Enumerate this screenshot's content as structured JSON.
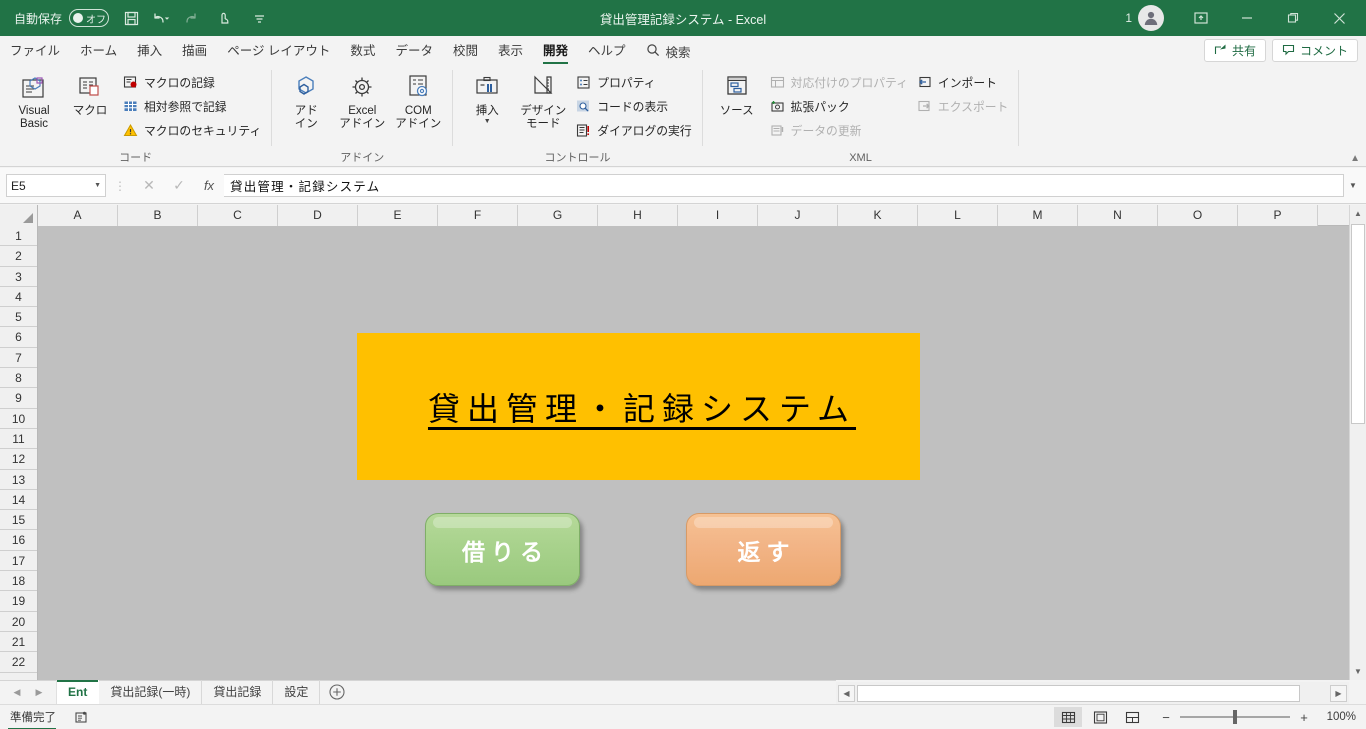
{
  "titlebar": {
    "autosave_label": "自動保存",
    "autosave_state": "オフ",
    "quick_access": [
      "save-icon",
      "undo-icon",
      "redo-icon",
      "touch-mode-icon",
      "customize-qat-icon"
    ],
    "document_title": "貸出管理記録システム  -  Excel",
    "user_count": "1",
    "window_buttons": [
      "ribbon-display-options",
      "minimize",
      "restore",
      "close"
    ]
  },
  "tabs": [
    {
      "label": "ファイル",
      "active": false
    },
    {
      "label": "ホーム",
      "active": false
    },
    {
      "label": "挿入",
      "active": false
    },
    {
      "label": "描画",
      "active": false
    },
    {
      "label": "ページ レイアウト",
      "active": false
    },
    {
      "label": "数式",
      "active": false
    },
    {
      "label": "データ",
      "active": false
    },
    {
      "label": "校閲",
      "active": false
    },
    {
      "label": "表示",
      "active": false
    },
    {
      "label": "開発",
      "active": true
    },
    {
      "label": "ヘルプ",
      "active": false
    }
  ],
  "search": {
    "label": "検索"
  },
  "tabbar_right": {
    "share": "共有",
    "comments": "コメント"
  },
  "ribbon": {
    "groups": [
      {
        "name": "code",
        "label": "コード",
        "big": [
          {
            "label": "Visual Basic",
            "icon": "visual-basic-icon"
          },
          {
            "label": "マクロ",
            "icon": "macro-icon"
          }
        ],
        "small": [
          {
            "label": "マクロの記録",
            "icon": "record-macro-icon",
            "disabled": false
          },
          {
            "label": "相対参照で記録",
            "icon": "relative-reference-icon",
            "disabled": false
          },
          {
            "label": "マクロのセキュリティ",
            "icon": "macro-security-icon",
            "disabled": false
          }
        ]
      },
      {
        "name": "addins",
        "label": "アドイン",
        "big": [
          {
            "label": "アド\nイン",
            "icon": "addins-icon"
          },
          {
            "label": "Excel\nアドイン",
            "icon": "excel-addins-icon"
          },
          {
            "label": "COM\nアドイン",
            "icon": "com-addins-icon"
          }
        ],
        "small": []
      },
      {
        "name": "controls",
        "label": "コントロール",
        "big": [
          {
            "label": "挿入",
            "icon": "insert-control-icon",
            "has_caret": true
          },
          {
            "label": "デザイン\nモード",
            "icon": "design-mode-icon"
          }
        ],
        "small": [
          {
            "label": "プロパティ",
            "icon": "properties-icon",
            "disabled": false
          },
          {
            "label": "コードの表示",
            "icon": "view-code-icon",
            "disabled": false
          },
          {
            "label": "ダイアログの実行",
            "icon": "run-dialog-icon",
            "disabled": false
          }
        ]
      },
      {
        "name": "xml",
        "label": "XML",
        "big": [
          {
            "label": "ソース",
            "icon": "xml-source-icon"
          }
        ],
        "small": [
          {
            "label": "対応付けのプロパティ",
            "icon": "map-properties-icon",
            "disabled": true
          },
          {
            "label": "拡張パック",
            "icon": "expansion-packs-icon",
            "disabled": false
          },
          {
            "label": "データの更新",
            "icon": "refresh-data-icon",
            "disabled": true
          }
        ],
        "small2": [
          {
            "label": "インポート",
            "icon": "import-icon",
            "disabled": false
          },
          {
            "label": "エクスポート",
            "icon": "export-icon",
            "disabled": true
          }
        ]
      }
    ]
  },
  "formula_bar": {
    "name_box": "E5",
    "cancel": "cancel-icon",
    "enter": "enter-icon",
    "fx": "fx-icon",
    "value": "貸出管理・記録システム"
  },
  "grid": {
    "columns": [
      "A",
      "B",
      "C",
      "D",
      "E",
      "F",
      "G",
      "H",
      "I",
      "J",
      "K",
      "L",
      "M",
      "N",
      "O",
      "P"
    ],
    "rows": [
      "1",
      "2",
      "3",
      "4",
      "5",
      "6",
      "7",
      "8",
      "9",
      "10",
      "11",
      "12",
      "13",
      "14",
      "15",
      "16",
      "17",
      "18",
      "19",
      "20",
      "21",
      "22"
    ],
    "background_color": "#c0c0c0"
  },
  "sheet_content": {
    "banner": {
      "text": "貸出管理・記録システム",
      "fill": "#ffc000"
    },
    "buttons": [
      {
        "label": "借りる",
        "name": "borrow-button",
        "fill": "#a8d28c"
      },
      {
        "label": "返す",
        "name": "return-button",
        "fill": "#f2b486"
      }
    ]
  },
  "sheet_tabs": {
    "items": [
      {
        "label": "Ent",
        "active": true
      },
      {
        "label": "貸出記録(一時)",
        "active": false
      },
      {
        "label": "貸出記録",
        "active": false
      },
      {
        "label": "設定",
        "active": false
      }
    ],
    "add_label": "add-sheet-icon"
  },
  "status_bar": {
    "mode": "準備完了",
    "accessibility": "accessibility-icon",
    "views": [
      {
        "name": "normal-view",
        "selected": true
      },
      {
        "name": "page-layout-view",
        "selected": false
      },
      {
        "name": "page-break-preview",
        "selected": false
      }
    ],
    "zoom_out": "−",
    "zoom_in": "+",
    "zoom_level": "100%"
  }
}
